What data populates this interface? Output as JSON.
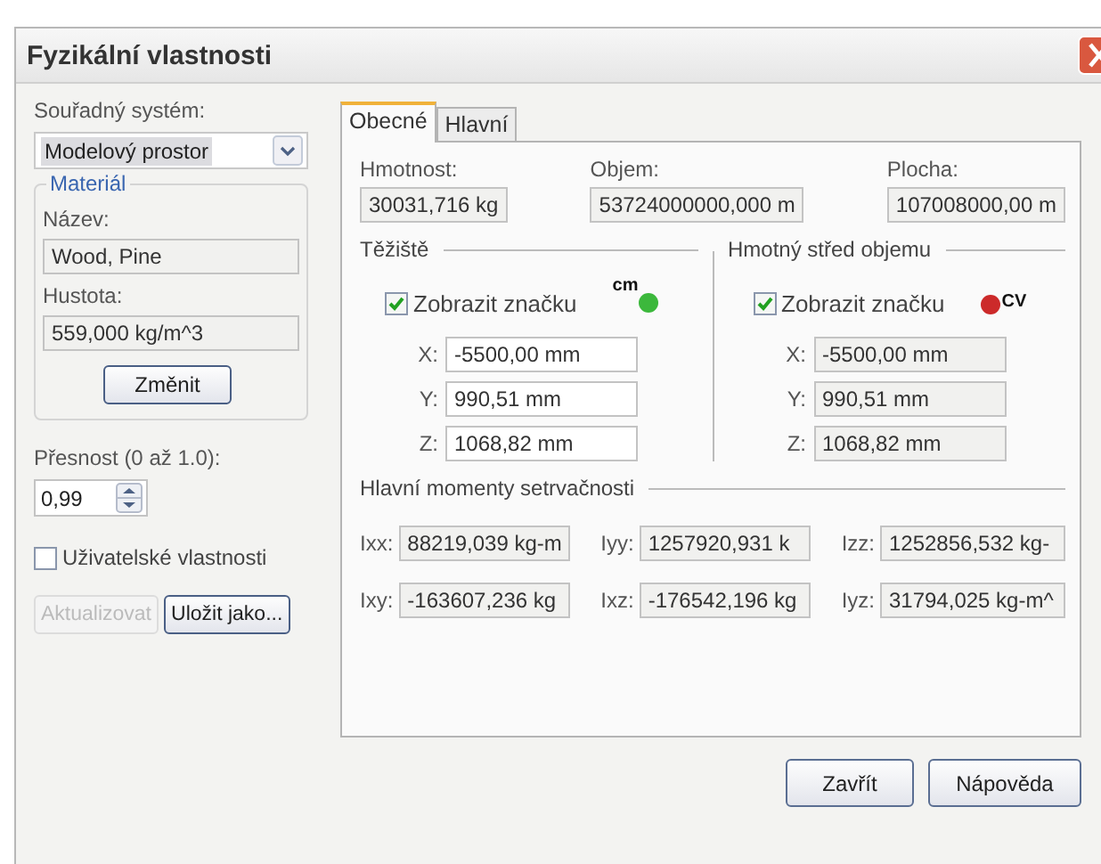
{
  "window": {
    "title": "Fyzikální vlastnosti"
  },
  "coordinate_system": {
    "label": "Souřadný systém:",
    "value": "Modelový prostor"
  },
  "material": {
    "title": "Materiál",
    "name_label": "Název:",
    "name": "Wood, Pine",
    "density_label": "Hustota:",
    "density": "559,000 kg/m^3",
    "change_button": "Změnit"
  },
  "precision": {
    "label": "Přesnost (0 až 1.0):",
    "value": "0,99"
  },
  "user_properties": {
    "label": "Uživatelské vlastnosti",
    "checked": false
  },
  "left_buttons": [
    {
      "label": "Aktualizovat",
      "disabled": true
    },
    {
      "label": "Uložit jako...",
      "disabled": false
    }
  ],
  "tabs": [
    {
      "label": "Obecné",
      "selected": true
    },
    {
      "label": "Hlavní",
      "selected": false
    }
  ],
  "summary": [
    {
      "label": "Hmotnost:",
      "value": "30031,716 kg"
    },
    {
      "label": "Objem:",
      "value": "53724000000,000 m"
    },
    {
      "label": "Plocha:",
      "value": "107008000,00 m"
    }
  ],
  "centers": [
    {
      "title": "Těžiště",
      "show_marker": {
        "label": "Zobrazit značku",
        "checked": true
      },
      "marker": {
        "text": "cm",
        "color": "#3cb83c",
        "kind": "label_left"
      },
      "coords": [
        {
          "axis": "X:",
          "value": "-5500,00 mm",
          "disabled": false
        },
        {
          "axis": "Y:",
          "value": "990,51 mm",
          "disabled": false
        },
        {
          "axis": "Z:",
          "value": "1068,82 mm",
          "disabled": false
        }
      ]
    },
    {
      "title": "Hmotný střed objemu",
      "show_marker": {
        "label": "Zobrazit značku",
        "checked": true
      },
      "marker": {
        "text": "CV",
        "color": "#cc2a2a",
        "kind": "label_right"
      },
      "coords": [
        {
          "axis": "X:",
          "value": "-5500,00 mm",
          "disabled": true
        },
        {
          "axis": "Y:",
          "value": "990,51 mm",
          "disabled": true
        },
        {
          "axis": "Z:",
          "value": "1068,82 mm",
          "disabled": true
        }
      ]
    }
  ],
  "moments": {
    "title": "Hlavní momenty setrvačnosti",
    "items": [
      {
        "label": "Ixx:",
        "value": "88219,039 kg-m"
      },
      {
        "label": "Iyy:",
        "value": "1257920,931 k"
      },
      {
        "label": "Izz:",
        "value": "1252856,532 kg-"
      },
      {
        "label": "Ixy:",
        "value": "-163607,236 kg"
      },
      {
        "label": "Ixz:",
        "value": "-176542,196 kg"
      },
      {
        "label": "Iyz:",
        "value": "31794,025 kg-m^"
      }
    ]
  },
  "dialog_buttons": [
    "Zavřít",
    "Nápověda"
  ]
}
